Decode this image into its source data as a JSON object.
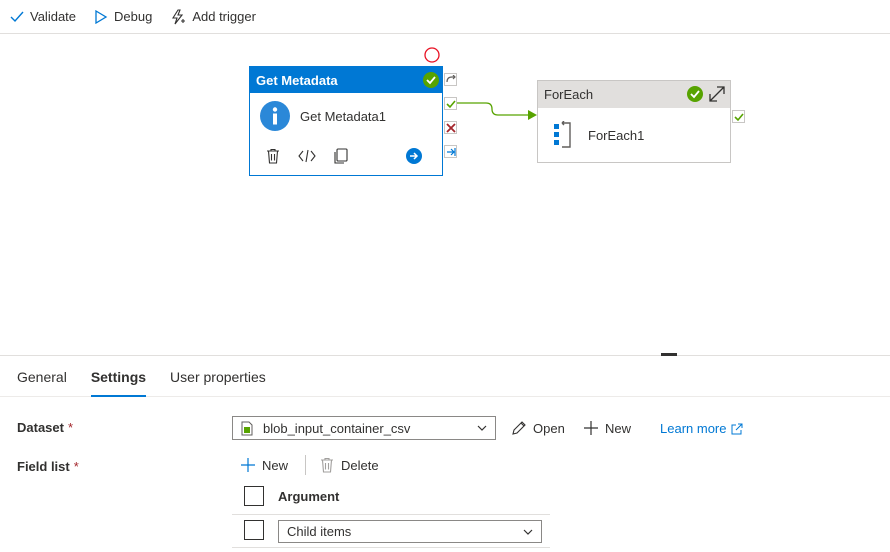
{
  "toolbar": {
    "validate": "Validate",
    "debug": "Debug",
    "add_trigger": "Add trigger"
  },
  "canvas": {
    "get_metadata": {
      "type_label": "Get Metadata",
      "name": "Get Metadata1"
    },
    "foreach": {
      "type_label": "ForEach",
      "name": "ForEach1"
    }
  },
  "tabs": [
    {
      "label": "General",
      "active": false
    },
    {
      "label": "Settings",
      "active": true
    },
    {
      "label": "User properties",
      "active": false
    }
  ],
  "settings": {
    "dataset": {
      "label": "Dataset",
      "required_mark": "*",
      "value": "blob_input_container_csv",
      "open": "Open",
      "new": "New",
      "learn_more": "Learn more"
    },
    "field_list": {
      "label": "Field list",
      "required_mark": "*",
      "new": "New",
      "delete": "Delete",
      "column_header": "Argument",
      "rows": [
        {
          "value": "Child items"
        }
      ]
    }
  },
  "colors": {
    "accent": "#0078d4",
    "success": "#57a300",
    "error": "#a4262c",
    "connector": "#57a300"
  }
}
